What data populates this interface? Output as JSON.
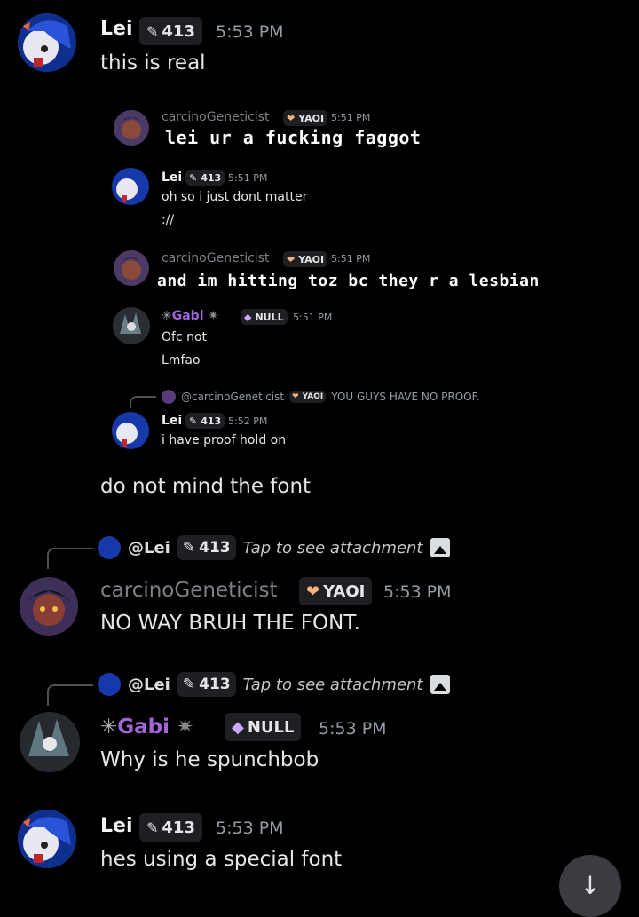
{
  "messages": {
    "m1": {
      "author": "Lei",
      "tag": "413",
      "time": "5:53 PM",
      "text": "this is real"
    },
    "m2": {
      "text": "do not mind the font"
    },
    "m3": {
      "reply": {
        "mention": "@Lei",
        "tag": "413",
        "attachment": "Tap to see attachment"
      },
      "author": "carcinoGeneticist",
      "tag": "YAOI",
      "time": "5:53 PM",
      "text": "NO WAY BRUH THE FONT."
    },
    "m4": {
      "reply": {
        "mention": "@Lei",
        "tag": "413",
        "attachment": "Tap to see attachment"
      },
      "author": "Gabi",
      "tag": "NULL",
      "time": "5:53 PM",
      "text": "Why is he spunchbob"
    },
    "m5": {
      "author": "Lei",
      "tag": "413",
      "time": "5:53 PM",
      "text": "hes using a special font"
    }
  },
  "screenshot": {
    "s1": {
      "author": "carcinoGeneticist",
      "tag": "YAOI",
      "time": "5:51 PM",
      "text": "lei ur a fucking faggot"
    },
    "s2": {
      "author": "Lei",
      "tag": "413",
      "time": "5:51 PM",
      "lines": [
        "oh so i just dont matter",
        "://"
      ]
    },
    "s3": {
      "author": "carcinoGeneticist",
      "tag": "YAOI",
      "time": "5:51 PM",
      "text": "and im hitting toz bc they r a lesbian"
    },
    "s4": {
      "author": "Gabi",
      "tag": "NULL",
      "time": "5:51 PM",
      "lines": [
        "Ofc not",
        "Lmfao"
      ]
    },
    "s5": {
      "reply": {
        "mention": "@carcinoGeneticist",
        "tag": "YAOI",
        "text": "YOU GUYS HAVE NO PROOF."
      },
      "author": "Lei",
      "tag": "413",
      "time": "5:52 PM",
      "text": "i have proof hold on"
    }
  },
  "colors": {
    "background": "#000000",
    "gabi": "#a366d9",
    "muted": "#7d8087"
  },
  "icons": {
    "scroll": "arrow-down-icon",
    "attachment": "image-icon"
  }
}
